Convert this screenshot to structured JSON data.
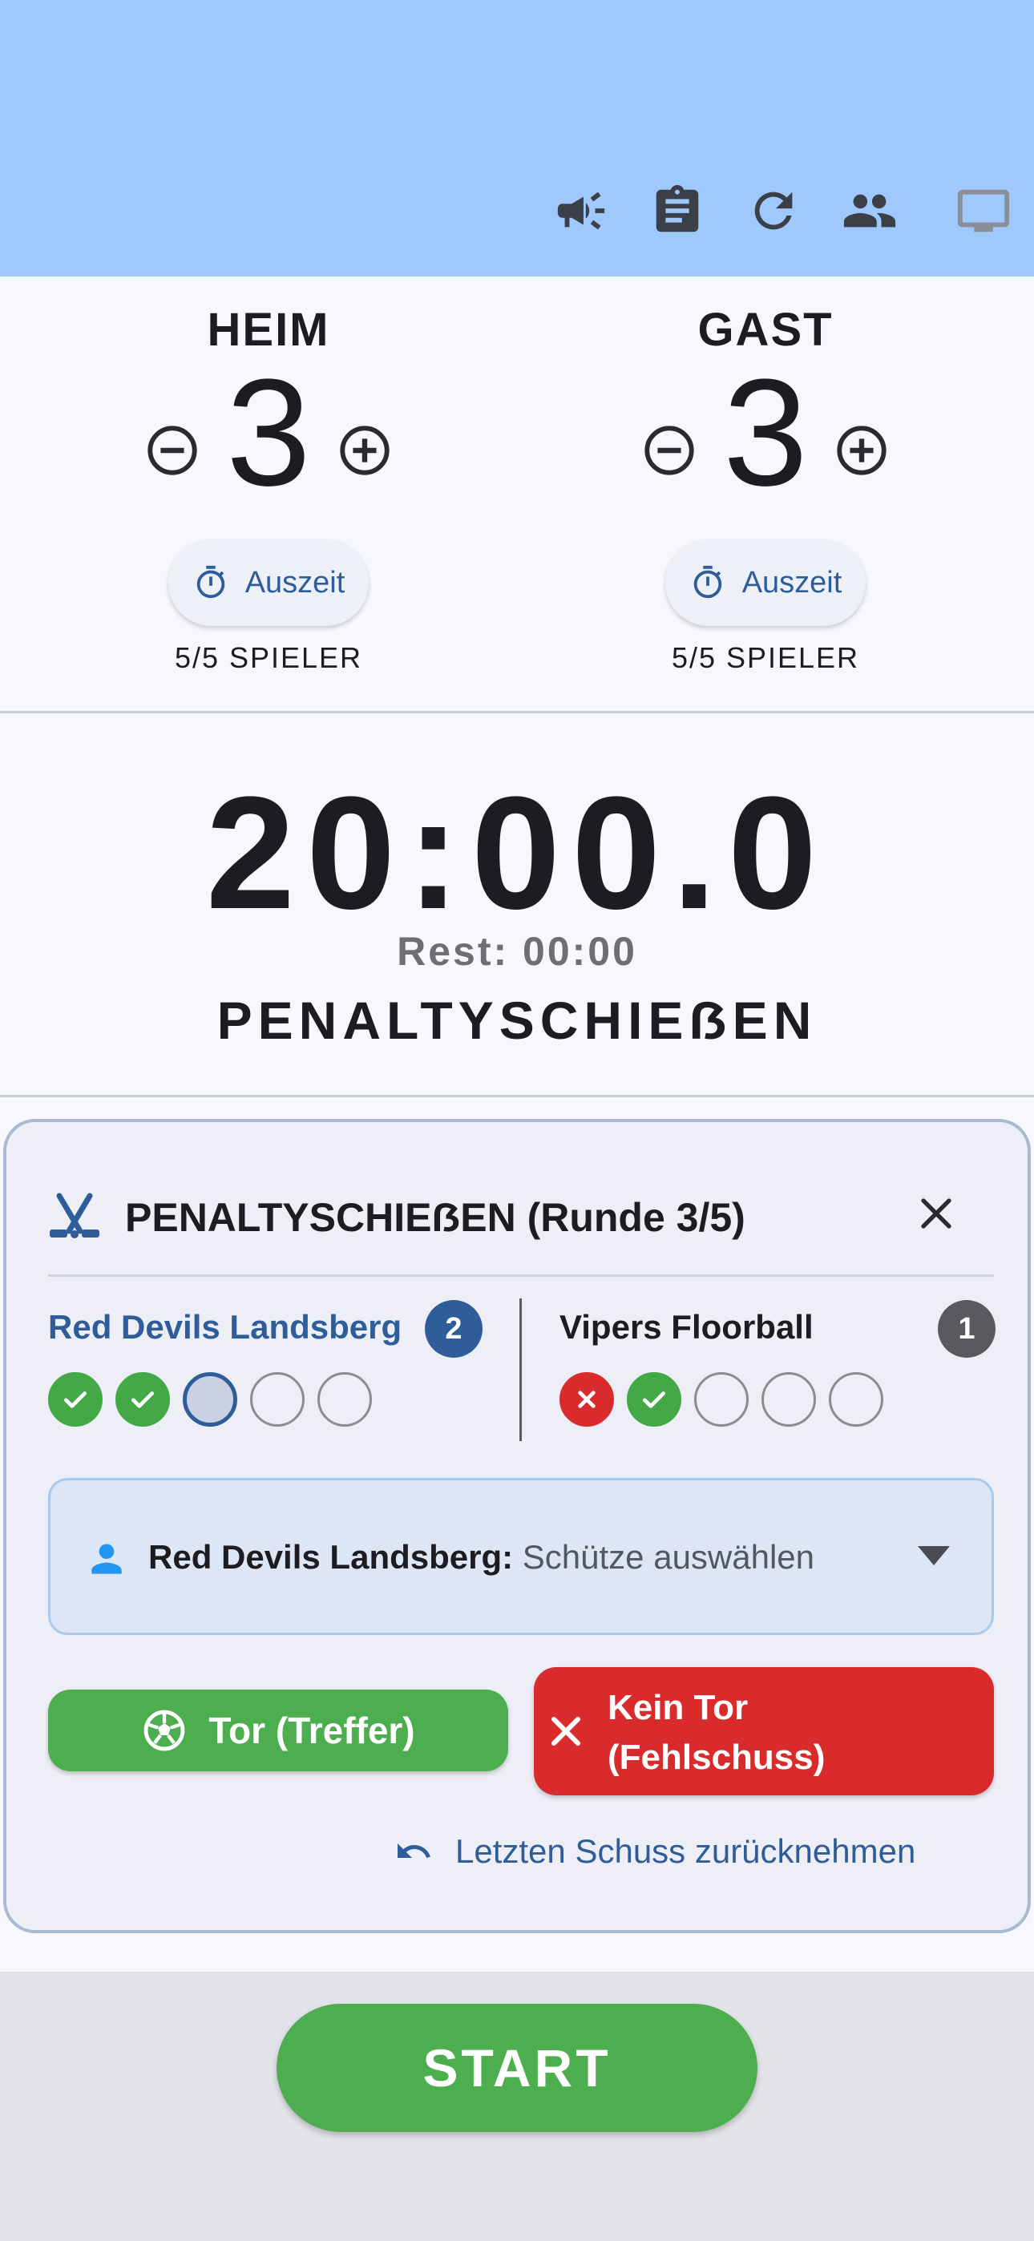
{
  "appbar": {
    "icons": [
      "megaphone-icon",
      "clipboard-icon",
      "refresh-icon",
      "people-icon",
      "monitor-icon"
    ],
    "background": "#9fc8fc"
  },
  "home": {
    "name": "HEIM",
    "score": "3",
    "timeout_label": "Auszeit",
    "players": "5/5 SPIELER"
  },
  "guest": {
    "name": "GAST",
    "score": "3",
    "timeout_label": "Auszeit",
    "players": "5/5 SPIELER"
  },
  "clock": {
    "time": "20:00.0",
    "rest": "Rest: 00:00",
    "period": "PENALTYSCHIEẞEN"
  },
  "penalty": {
    "title": "PENALTYSCHIEẞEN (Runde 3/5)",
    "left_team": {
      "name": "Red Devils Landsberg",
      "goals": "2",
      "shots": [
        "hit",
        "hit",
        "current",
        "pending",
        "pending"
      ]
    },
    "right_team": {
      "name": "Vipers Floorball",
      "goals": "1",
      "shots": [
        "miss",
        "hit",
        "pending",
        "pending",
        "pending"
      ]
    },
    "shooter": {
      "team_label": "Red Devils Landsberg:",
      "placeholder": "Schütze auswählen"
    },
    "goal_button": "Tor (Treffer)",
    "miss_button_line1": "Kein Tor",
    "miss_button_line2": "(Fehlschuss)",
    "undo_label": "Letzten Schuss zurücknehmen"
  },
  "start_button": "START",
  "colors": {
    "accent_blue": "#2f5d9a",
    "goal_green": "#4cae4f",
    "miss_red": "#d92b2b"
  }
}
